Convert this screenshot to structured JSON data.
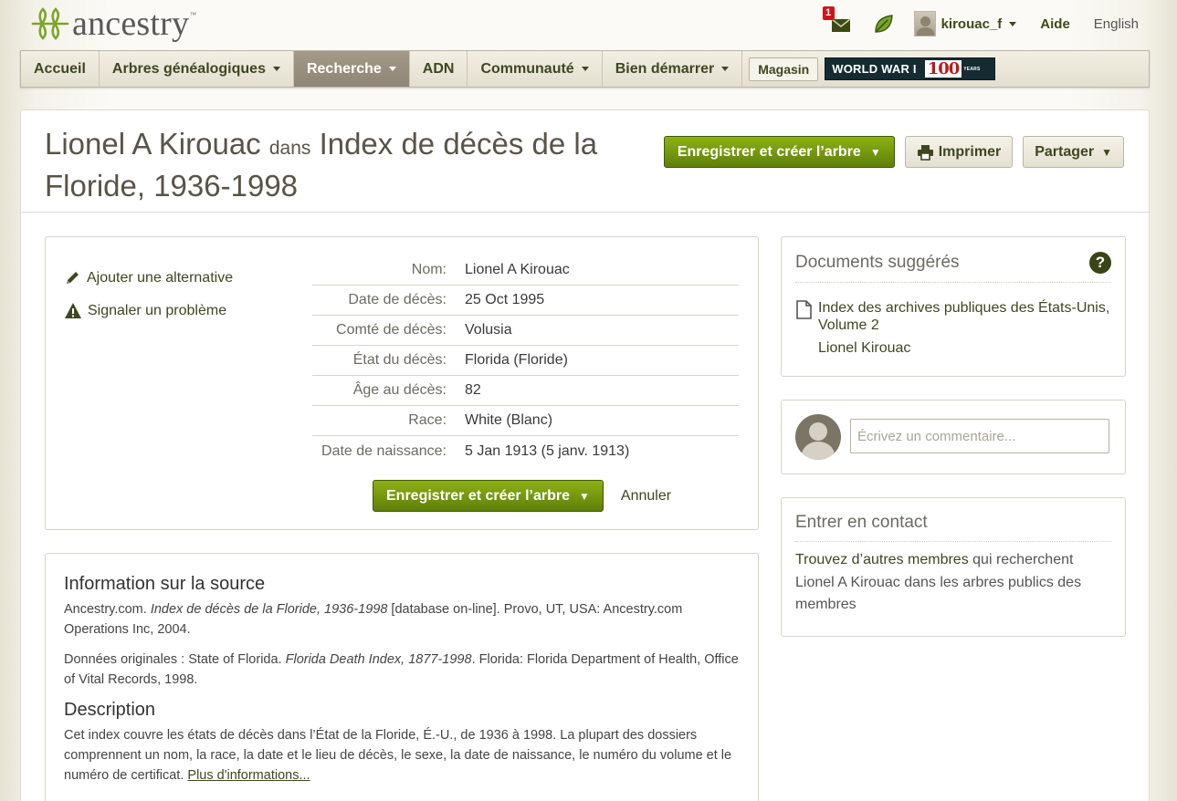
{
  "brand": {
    "name": "ancestry",
    "trademark": "™"
  },
  "header": {
    "message_count": "1",
    "username": "kirouac_f",
    "help": "Aide",
    "language": "English"
  },
  "nav": {
    "items": [
      {
        "label": "Accueil"
      },
      {
        "label": "Arbres généalogiques"
      },
      {
        "label": "Recherche"
      },
      {
        "label": "ADN"
      },
      {
        "label": "Communauté"
      },
      {
        "label": "Bien démarrer"
      }
    ],
    "store": "Magasin",
    "banner": {
      "text": "WORLD WAR I",
      "number": "100",
      "small": "YEARS"
    }
  },
  "record_header": {
    "name": "Lionel A Kirouac",
    "connector": "dans",
    "collection": "Index de décès de la Floride, 1936-1998",
    "save_button": "Enregistrer et créer l’arbre",
    "print_button": "Imprimer",
    "share_button": "Partager"
  },
  "record": {
    "side_links": [
      {
        "label": "Ajouter une alternative",
        "icon": "pencil-icon"
      },
      {
        "label": "Signaler un problème",
        "icon": "warning-icon"
      }
    ],
    "facts": [
      {
        "label": "Nom:",
        "value": "Lionel A Kirouac"
      },
      {
        "label": "Date de décès:",
        "value": "25 Oct 1995"
      },
      {
        "label": "Comté de décès:",
        "value": "Volusia"
      },
      {
        "label": "État du décès:",
        "value": "Florida (Floride)"
      },
      {
        "label": "Âge au décès:",
        "value": "82"
      },
      {
        "label": "Race:",
        "value": "White (Blanc)"
      },
      {
        "label": "Date de naissance:",
        "value": "5 Jan 1913 (5 janv. 1913)"
      }
    ],
    "save_button": "Enregistrer et créer l’arbre",
    "cancel": "Annuler"
  },
  "source": {
    "heading": "Information sur la source",
    "citation": {
      "prefix": "Ancestry.com. ",
      "title": "Index de décès de la Floride, 1936-1998",
      "suffix": " [database on-line]. Provo, UT, USA: Ancestry.com Operations Inc, 2004."
    },
    "original": {
      "prefix": "Données originales : State of Florida. ",
      "title": "Florida Death Index, 1877-1998",
      "suffix": ". Florida: Florida Department of Health, Office of Vital Records, 1998."
    },
    "description_heading": "Description",
    "description": "Cet index couvre les états de décès dans l’État de la Floride, É.-U., de 1936 à 1998. La plupart des dossiers comprennent un nom, la race, la date et le lieu de décès, le sexe, la date de naissance, le numéro du volume et le numéro de certificat. ",
    "more_link": "Plus d'informations..."
  },
  "suggested": {
    "heading": "Documents suggérés",
    "items": [
      {
        "title": "Index des archives publiques des États-Unis, Volume 2",
        "person": "Lionel Kirouac"
      }
    ]
  },
  "comment": {
    "placeholder": "Écrivez un commentaire..."
  },
  "contact": {
    "heading": "Entrer en contact",
    "link": "Trouvez d’autres membres",
    "text": " qui recherchent Lionel A Kirouac dans les arbres publics des membres"
  },
  "colors": {
    "accent_green": "#6e9410",
    "nav_active": "#978e7d",
    "link_green": "#3e4720",
    "badge_red": "#d1131b"
  }
}
